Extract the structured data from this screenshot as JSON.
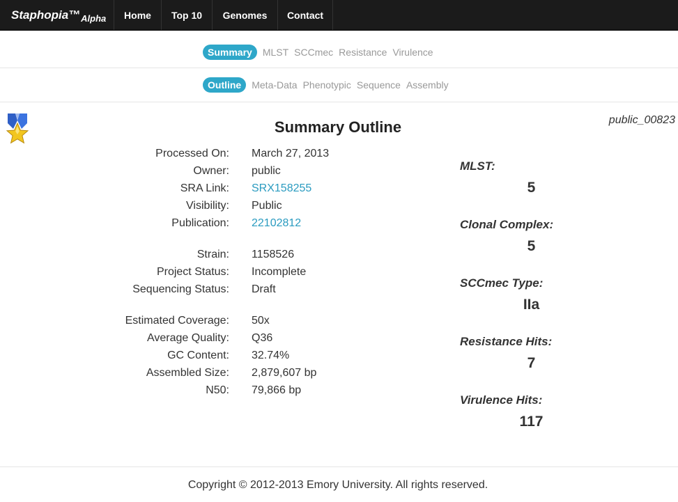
{
  "navbar": {
    "brand": "Staphopia™",
    "brand_sub": "Alpha",
    "items": [
      "Home",
      "Top 10",
      "Genomes",
      "Contact"
    ]
  },
  "tabs_primary": {
    "active": "Summary",
    "items": [
      "MLST",
      "SCCmec",
      "Resistance",
      "Virulence"
    ]
  },
  "tabs_secondary": {
    "active": "Outline",
    "items": [
      "Meta-Data",
      "Phenotypic",
      "Sequence",
      "Assembly"
    ]
  },
  "page": {
    "title": "Summary Outline",
    "sample_id": "public_00823",
    "badge_icon": "star-medal-icon"
  },
  "details": {
    "processed_on": {
      "label": "Processed On:",
      "value": "March 27, 2013"
    },
    "owner": {
      "label": "Owner:",
      "value": "public"
    },
    "sra_link": {
      "label": "SRA Link:",
      "value": "SRX158255"
    },
    "visibility": {
      "label": "Visibility:",
      "value": "Public"
    },
    "publication": {
      "label": "Publication:",
      "value": "22102812"
    },
    "strain": {
      "label": "Strain:",
      "value": "1158526"
    },
    "project_status": {
      "label": "Project Status:",
      "value": "Incomplete"
    },
    "sequencing_status": {
      "label": "Sequencing Status:",
      "value": "Draft"
    },
    "estimated_coverage": {
      "label": "Estimated Coverage:",
      "value": "50x"
    },
    "average_quality": {
      "label": "Average Quality:",
      "value": "Q36"
    },
    "gc_content": {
      "label": "GC Content:",
      "value": "32.74%"
    },
    "assembled_size": {
      "label": "Assembled Size:",
      "value": "2,879,607 bp"
    },
    "n50": {
      "label": "N50:",
      "value": "79,866 bp"
    }
  },
  "stats": {
    "mlst": {
      "label": "MLST:",
      "value": "5"
    },
    "clonal_complex": {
      "label": "Clonal Complex:",
      "value": "5"
    },
    "sccmec_type": {
      "label": "SCCmec Type:",
      "value": "IIa"
    },
    "resistance_hits": {
      "label": "Resistance Hits:",
      "value": "7"
    },
    "virulence_hits": {
      "label": "Virulence Hits:",
      "value": "117"
    }
  },
  "footer": {
    "copyright": "Copyright © 2012-2013 Emory University. All rights reserved."
  },
  "colors": {
    "navbar_bg": "#1b1b1b",
    "accent": "#2ea7c9",
    "link": "#2a9bc0"
  }
}
